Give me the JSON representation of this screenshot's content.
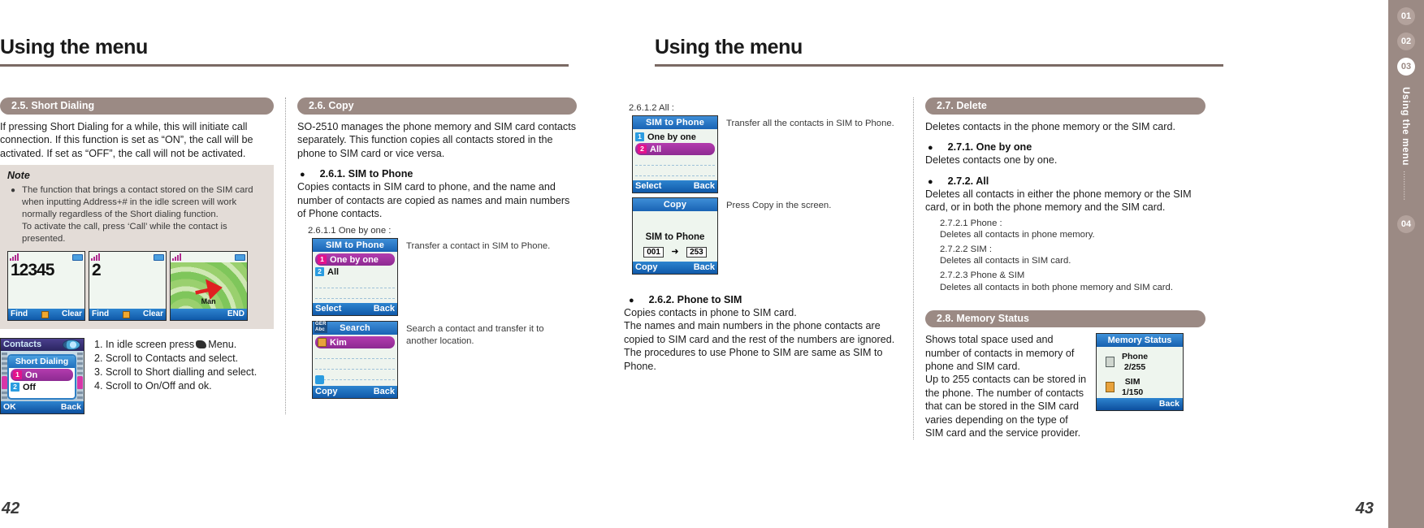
{
  "left_page": {
    "header": "Using the menu",
    "page_number": "42",
    "col1": {
      "section_title": "2.5. Short Dialing",
      "intro": "If pressing Short Dialing for a while, this will initiate call connection. If this function is set as “ON”, the call will be activated. If set as “OFF”, the call will not be activated.",
      "note_title": "Note",
      "note_text": "The function that brings a contact stored on the SIM card when inputting Address+# in the idle screen will work normally regardless of the Short dialing function.\nTo activate the call, press ‘Call’ while the contact is presented.",
      "idle_screens": [
        {
          "display": "12345",
          "left_soft": "Find",
          "right_soft": "Clear"
        },
        {
          "display": "2",
          "left_soft": "Find",
          "right_soft": "Clear"
        },
        {
          "display": "",
          "map_label": "Man",
          "right_soft": "END"
        }
      ],
      "contacts_screen": {
        "title": "Contacts",
        "popup_title": "Short Dialing",
        "items": [
          {
            "num": "1",
            "label": "On",
            "selected": true
          },
          {
            "num": "2",
            "label": "Off",
            "selected": false
          }
        ],
        "left_soft": "OK",
        "right_soft": "Back"
      },
      "steps": [
        "1. In idle screen press",
        "Menu.",
        "2. Scroll to Contacts and select.",
        "3. Scroll to Short dialling and select.",
        "4. Scroll to On/Off and ok."
      ]
    },
    "col2": {
      "section_title": "2.6. Copy",
      "intro": "SO-2510 manages the phone memory and SIM card contacts separately. This function copies all contacts stored in the phone to SIM card or vice versa.",
      "sub1_title": "2.6.1. SIM to Phone",
      "sub1_text": "Copies contacts in SIM card to phone, and the name and number of contacts are copied as names and main numbers of Phone contacts.",
      "item1_label": "2.6.1.1 One by one :",
      "screen1": {
        "title": "SIM to Phone",
        "items": [
          {
            "num": "1",
            "label": "One by one",
            "selected": true
          },
          {
            "num": "2",
            "label": "All",
            "selected": false
          }
        ],
        "left_soft": "Select",
        "right_soft": "Back"
      },
      "screen1_caption": "Transfer a contact in SIM to Phone.",
      "screen2": {
        "ime_top": "GER",
        "ime_bottom": "Abc",
        "title": "Search",
        "items": [
          {
            "label": "Kim",
            "selected": true
          }
        ],
        "left_soft": "Copy",
        "right_soft": "Back"
      },
      "screen2_caption": "Search a contact and transfer it to another location."
    }
  },
  "right_page": {
    "header": "Using the menu",
    "page_number": "43",
    "col1": {
      "item_label": "2.6.1.2 All :",
      "screen1": {
        "title": "SIM to Phone",
        "items": [
          {
            "num": "1",
            "label": "One by one",
            "selected": false
          },
          {
            "num": "2",
            "label": "All",
            "selected": true
          }
        ],
        "left_soft": "Select",
        "right_soft": "Back"
      },
      "screen1_caption": "Transfer all the contacts in SIM to Phone.",
      "screen2": {
        "title": "Copy",
        "middle": "SIM to Phone",
        "from": "001",
        "to": "253",
        "left_soft": "Copy",
        "right_soft": "Back"
      },
      "screen2_caption": "Press Copy in the screen.",
      "sub2_title": "2.6.2. Phone to SIM",
      "sub2_text": "Copies contacts in phone to SIM card.\nThe names and main numbers in the phone contacts are copied to SIM card and the rest of the numbers are ignored.\nThe procedures to use Phone to SIM are same as SIM to Phone."
    },
    "col2": {
      "section_title": "2.7. Delete",
      "intro": "Deletes contacts in the phone memory or the SIM card.",
      "sub1_title": "2.7.1. One by one",
      "sub1_text": "Deletes contacts one by one.",
      "sub2_title": "2.7.2. All",
      "sub2_text": "Deletes all contacts in either the phone memory or the SIM card, or in both the phone memory and the SIM card.",
      "details": [
        {
          "label": "2.7.2.1 Phone :",
          "text": "Deletes all contacts in phone memory."
        },
        {
          "label": "2.7.2.2 SIM :",
          "text": "Deletes all contacts in SIM card."
        },
        {
          "label": "2.7.2.3 Phone & SIM",
          "text": "Deletes all contacts in both phone memory and SIM card."
        }
      ],
      "memory_section_title": "2.8. Memory Status",
      "memory_text": "Shows total space used and number of contacts in memory of phone and SIM card.\nUp to 255 contacts can be stored in the phone. The number of contacts that can be stored in the SIM card varies depending on the type of SIM card and the service provider.",
      "memory_screen": {
        "title": "Memory Status",
        "rows": [
          {
            "label": "Phone",
            "value": "2/255"
          },
          {
            "label": "SIM",
            "value": "1/150"
          }
        ],
        "right_soft": "Back"
      }
    }
  },
  "rail": {
    "tabs": [
      "01",
      "02",
      "03",
      "04"
    ],
    "active_index": 2,
    "label": "Using the menu",
    "dots": "............"
  },
  "colors": {
    "accent": "#9b8a84",
    "note_bg": "#e3dcd7",
    "screen_blue": "#1963b4",
    "highlight_magenta": "#8d2a92"
  }
}
